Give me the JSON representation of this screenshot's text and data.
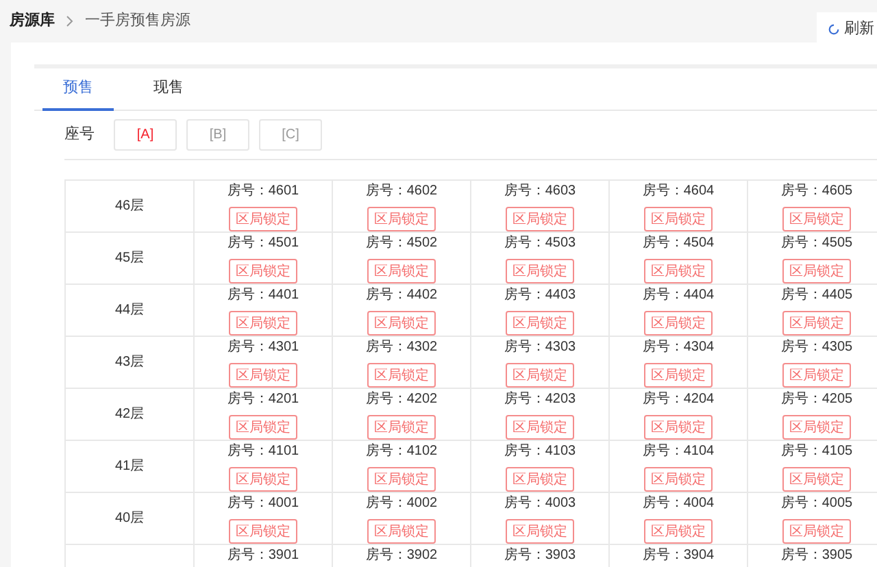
{
  "breadcrumb": [
    "房源库",
    "一手房预售房源"
  ],
  "refresh_button": {
    "label": "刷新"
  },
  "tabs": [
    {
      "label": "预售",
      "selected": true
    },
    {
      "label": "现售",
      "selected": false
    }
  ],
  "seat_filter": {
    "label": "座号",
    "options": [
      {
        "label": "[A]",
        "selected": true
      },
      {
        "label": "[B]",
        "selected": false
      },
      {
        "label": "[C]",
        "selected": false
      }
    ]
  },
  "floors": [
    {
      "floor": "46层",
      "units": [
        {
          "room": "房号：4601",
          "status": "区局锁定"
        },
        {
          "room": "房号：4602",
          "status": "区局锁定"
        },
        {
          "room": "房号：4603",
          "status": "区局锁定"
        },
        {
          "room": "房号：4604",
          "status": "区局锁定"
        },
        {
          "room": "房号：4605",
          "status": "区局锁定"
        }
      ]
    },
    {
      "floor": "45层",
      "units": [
        {
          "room": "房号：4501",
          "status": "区局锁定"
        },
        {
          "room": "房号：4502",
          "status": "区局锁定"
        },
        {
          "room": "房号：4503",
          "status": "区局锁定"
        },
        {
          "room": "房号：4504",
          "status": "区局锁定"
        },
        {
          "room": "房号：4505",
          "status": "区局锁定"
        }
      ]
    },
    {
      "floor": "44层",
      "units": [
        {
          "room": "房号：4401",
          "status": "区局锁定"
        },
        {
          "room": "房号：4402",
          "status": "区局锁定"
        },
        {
          "room": "房号：4403",
          "status": "区局锁定"
        },
        {
          "room": "房号：4404",
          "status": "区局锁定"
        },
        {
          "room": "房号：4405",
          "status": "区局锁定"
        }
      ]
    },
    {
      "floor": "43层",
      "units": [
        {
          "room": "房号：4301",
          "status": "区局锁定"
        },
        {
          "room": "房号：4302",
          "status": "区局锁定"
        },
        {
          "room": "房号：4303",
          "status": "区局锁定"
        },
        {
          "room": "房号：4304",
          "status": "区局锁定"
        },
        {
          "room": "房号：4305",
          "status": "区局锁定"
        }
      ]
    },
    {
      "floor": "42层",
      "units": [
        {
          "room": "房号：4201",
          "status": "区局锁定"
        },
        {
          "room": "房号：4202",
          "status": "区局锁定"
        },
        {
          "room": "房号：4203",
          "status": "区局锁定"
        },
        {
          "room": "房号：4204",
          "status": "区局锁定"
        },
        {
          "room": "房号：4205",
          "status": "区局锁定"
        }
      ]
    },
    {
      "floor": "41层",
      "units": [
        {
          "room": "房号：4101",
          "status": "区局锁定"
        },
        {
          "room": "房号：4102",
          "status": "区局锁定"
        },
        {
          "room": "房号：4103",
          "status": "区局锁定"
        },
        {
          "room": "房号：4104",
          "status": "区局锁定"
        },
        {
          "room": "房号：4105",
          "status": "区局锁定"
        }
      ]
    },
    {
      "floor": "40层",
      "units": [
        {
          "room": "房号：4001",
          "status": "区局锁定"
        },
        {
          "room": "房号：4002",
          "status": "区局锁定"
        },
        {
          "room": "房号：4003",
          "status": "区局锁定"
        },
        {
          "room": "房号：4004",
          "status": "区局锁定"
        },
        {
          "room": "房号：4005",
          "status": "区局锁定"
        }
      ]
    },
    {
      "units": [
        {
          "room": "房号：3901"
        },
        {
          "room": "房号：3902"
        },
        {
          "room": "房号：3903"
        },
        {
          "room": "房号：3904"
        },
        {
          "room": "房号：3905"
        }
      ]
    }
  ]
}
